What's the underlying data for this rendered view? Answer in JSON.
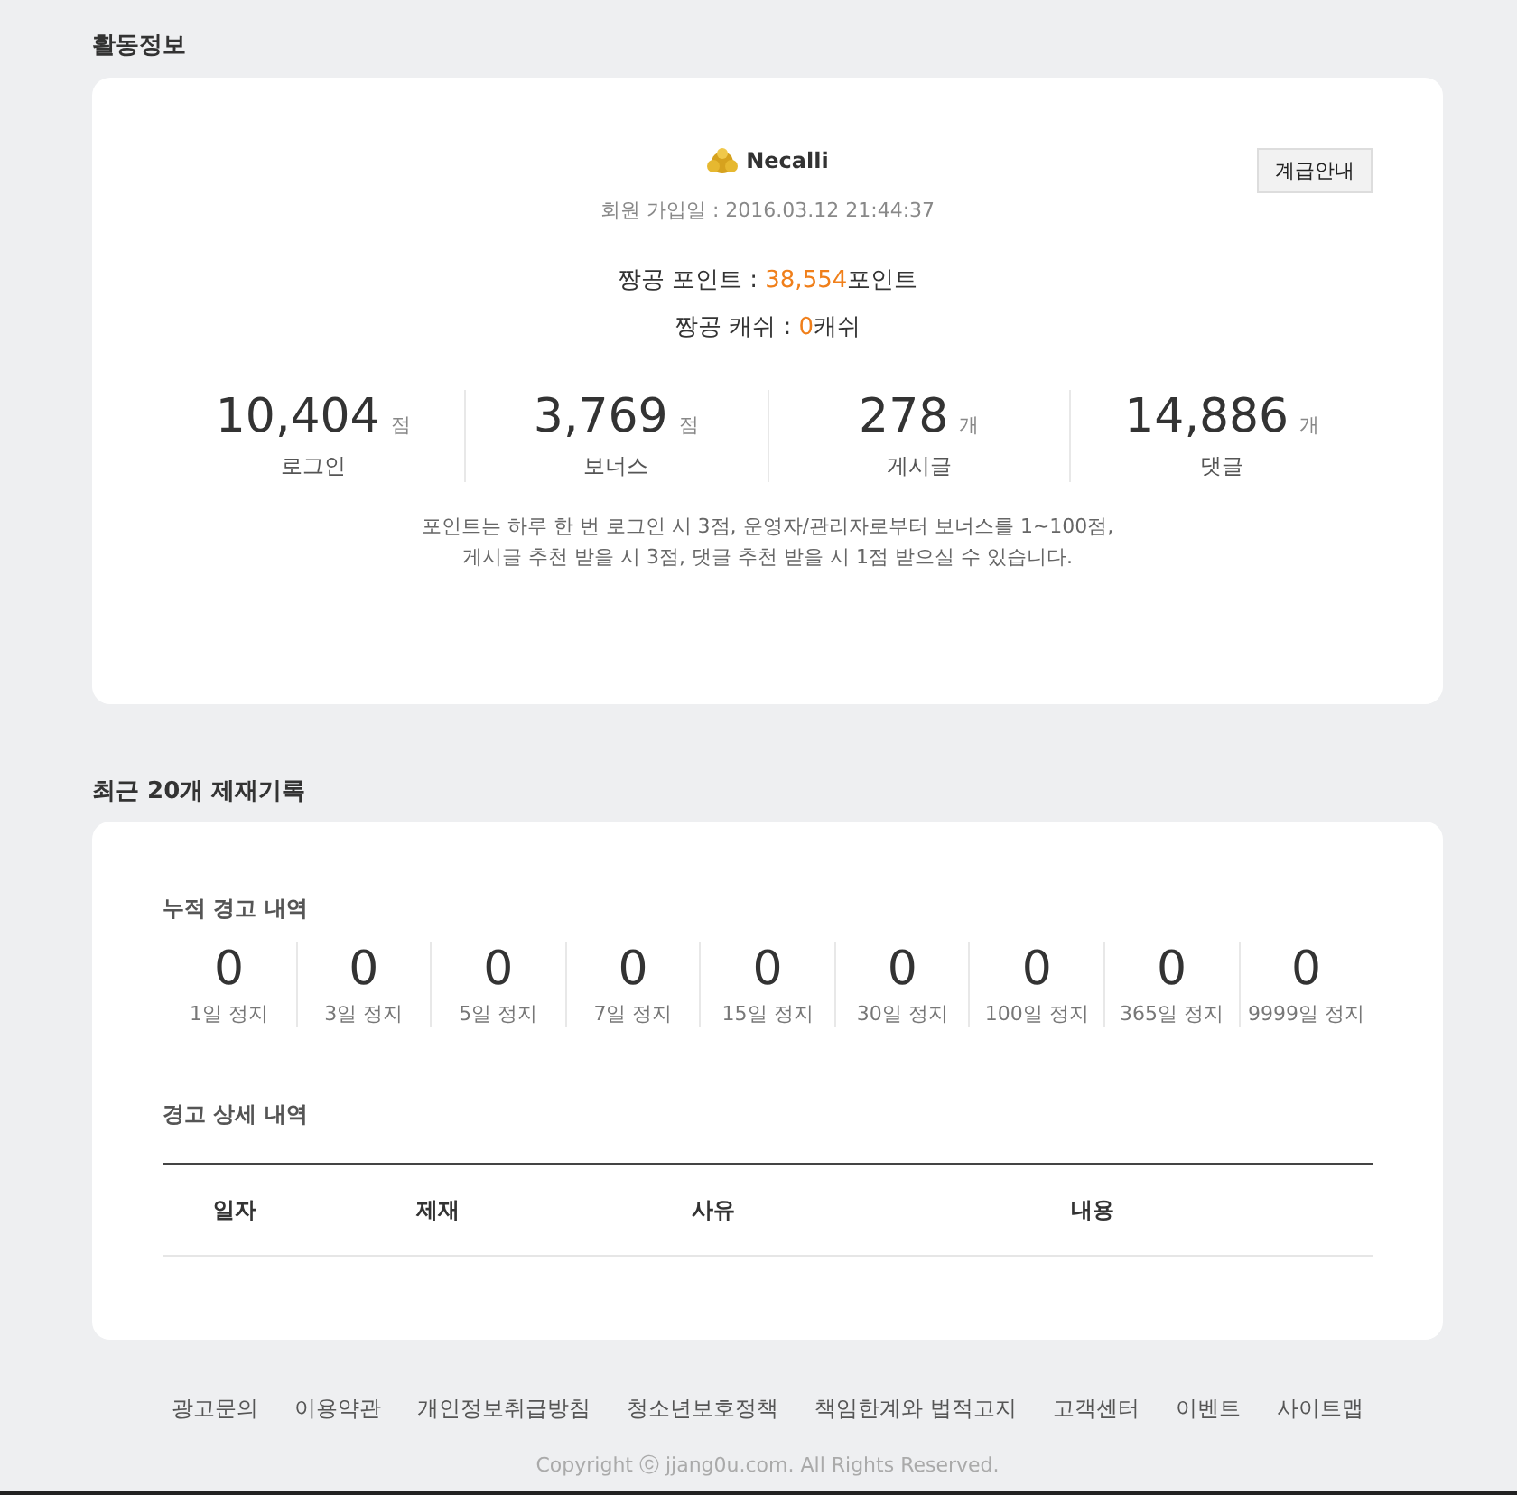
{
  "activity": {
    "title": "활동정보",
    "user": {
      "name": "Necalli",
      "joined": "회원 가입일 : 2016.03.12 21:44:37"
    },
    "grade_button": "계급안내",
    "points": {
      "label": "짱공 포인트 : ",
      "value": "38,554",
      "unit": "포인트"
    },
    "cash": {
      "label": "짱공 캐쉬 : ",
      "value": "0",
      "unit": "캐쉬"
    },
    "stats": [
      {
        "value": "10,404",
        "unit": "점",
        "label": "로그인"
      },
      {
        "value": "3,769",
        "unit": "점",
        "label": "보너스"
      },
      {
        "value": "278",
        "unit": "개",
        "label": "게시글"
      },
      {
        "value": "14,886",
        "unit": "개",
        "label": "댓글"
      }
    ],
    "note": [
      "포인트는 하루 한 번  로그인 시 3점, 운영자/관리자로부터  보너스를 1~100점,",
      "게시글 추천 받을 시 3점, 댓글 추천 받을 시 1점 받으실 수 있습니다."
    ]
  },
  "sanctions": {
    "title": "최근 20개 제재기록",
    "summary_title": "누적 경고 내역",
    "counts": [
      {
        "value": "0",
        "label": "1일 정지"
      },
      {
        "value": "0",
        "label": "3일 정지"
      },
      {
        "value": "0",
        "label": "5일 정지"
      },
      {
        "value": "0",
        "label": "7일 정지"
      },
      {
        "value": "0",
        "label": "15일 정지"
      },
      {
        "value": "0",
        "label": "30일 정지"
      },
      {
        "value": "0",
        "label": "100일 정지"
      },
      {
        "value": "0",
        "label": "365일 정지"
      },
      {
        "value": "0",
        "label": "9999일 정지"
      }
    ],
    "detail_title": "경고 상세 내역",
    "table": {
      "columns": [
        "일자",
        "제재",
        "사유",
        "내용"
      ]
    }
  },
  "footer": {
    "links": [
      "광고문의",
      "이용약관",
      "개인정보취급방침",
      "청소년보호정책",
      "책임한계와 법적고지",
      "고객센터",
      "이벤트",
      "사이트맵"
    ],
    "copyright": "Copyright ⓒ jjang0u.com. All Rights Reserved."
  }
}
